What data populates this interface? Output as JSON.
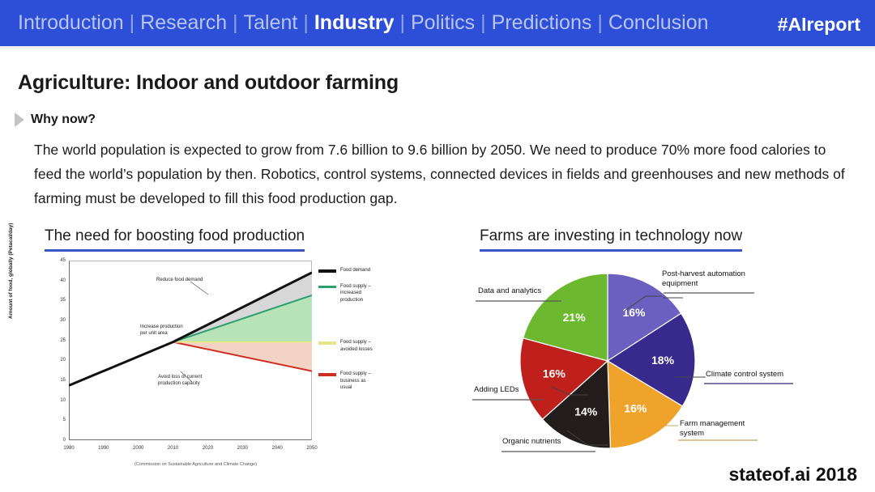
{
  "nav": {
    "items": [
      {
        "label": "Introduction",
        "active": false
      },
      {
        "label": "Research",
        "active": false
      },
      {
        "label": "Talent",
        "active": false
      },
      {
        "label": "Industry",
        "active": true
      },
      {
        "label": "Politics",
        "active": false
      },
      {
        "label": "Predictions",
        "active": false
      },
      {
        "label": "Conclusion",
        "active": false
      }
    ],
    "separator": "|",
    "hashtag": "#AIreport",
    "background_color": "#2d4fd8",
    "active_color": "#ffffff",
    "inactive_color": "#b9c6f2"
  },
  "slide": {
    "title": "Agriculture: Indoor and outdoor farming",
    "bullet_label": "Why now?",
    "body": "The world population is expected to grow from 7.6 billion to 9.6 billion by 2050. We need to produce 70% more food calories to feed the world’s population by then. Robotics, control systems, connected devices in fields and greenhouses and new methods of farming must be developed to fill this food production gap.",
    "footer_brand": "stateof.ai 2018",
    "section_left_heading": "The need for boosting food production",
    "section_right_heading": "Farms are investing in technology now",
    "underline_color": "#3a56c4"
  },
  "chart_data": [
    {
      "type": "line",
      "title": "The need for boosting food production",
      "xlabel": "",
      "ylabel": "Amount of food, globally (Petacal/day)",
      "xlim": [
        1980,
        2050
      ],
      "ylim": [
        0,
        45
      ],
      "xticks": [
        1980,
        1990,
        2000,
        2010,
        2020,
        2030,
        2040,
        2050
      ],
      "yticks": [
        0,
        5,
        10,
        15,
        20,
        25,
        30,
        35,
        40,
        45
      ],
      "grid": false,
      "legend_position": "right",
      "caption": "(Commission on Sustainable Agriculture and Climate Change)",
      "x": [
        1980,
        2010,
        2050
      ],
      "series": [
        {
          "name": "Food demand",
          "color": "#111111",
          "values": [
            13.7,
            24.6,
            42.0
          ]
        },
        {
          "name": "Food supply – increased production",
          "color": "#2f9e6e",
          "values": [
            13.7,
            24.6,
            36.3
          ]
        },
        {
          "name": "Food supply – avoided losses",
          "color": "#e8e58a",
          "values": [
            13.7,
            24.6,
            24.6
          ]
        },
        {
          "name": "Food supply – business as usual",
          "color": "#cc2d20",
          "values": [
            13.7,
            24.6,
            17.3
          ]
        }
      ],
      "annotations": [
        {
          "text": "Reduce food demand",
          "x": 2026,
          "y": 38.5
        },
        {
          "text": "Increase production\nper unit area",
          "x": 2024,
          "y": 29.5
        },
        {
          "text": "Avoid loss of current\nproduction capacity",
          "x": 2029,
          "y": 19.0
        }
      ]
    },
    {
      "type": "pie",
      "title": "Farms are investing in technology now",
      "legend_position": "callout-labels",
      "categories": [
        "Post-harvest automation equipment",
        "Climate control system",
        "Farm management system",
        "Organic nutrients",
        "Adding LEDs",
        "Data and analytics"
      ],
      "values": [
        16,
        18,
        16,
        14,
        16,
        21
      ],
      "value_labels": [
        "16%",
        "18%",
        "16%",
        "14%",
        "16%",
        "21%"
      ],
      "colors": [
        "#6b5fbf",
        "#382a8c",
        "#f0a32a",
        "#231c1c",
        "#c0201c",
        "#6cb82e"
      ],
      "label_text_colors": [
        "#ffffff",
        "#ffffff",
        "#ffffff",
        "#ffffff",
        "#ffffff",
        "#ffffff"
      ]
    }
  ]
}
